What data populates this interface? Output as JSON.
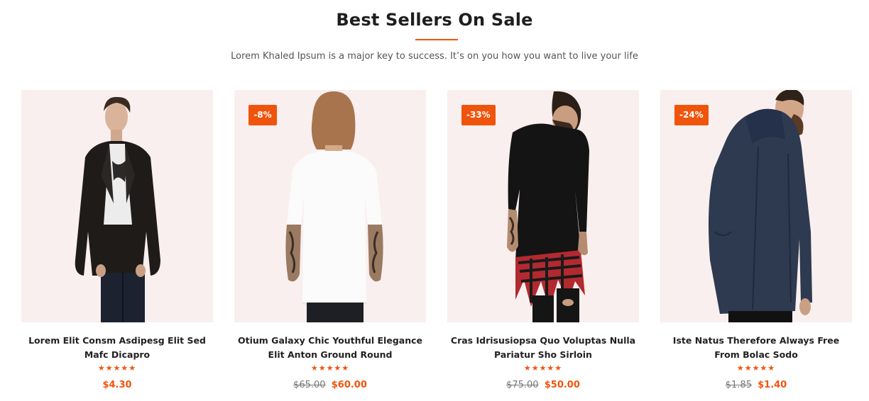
{
  "section": {
    "title": "Best Sellers On Sale",
    "subtitle": "Lorem Khaled Ipsum is a major key to success. It’s on you how you want to live your life",
    "accent_color": "#f0540c"
  },
  "products": [
    {
      "name": "Lorem Elit Consm Asdipesg Elit Sed Mafc Dicapro",
      "discount": "",
      "rating": 5,
      "stars": "★★★★★",
      "old_price": "",
      "price": "$4.30",
      "image": "man-leather-jacket-photo"
    },
    {
      "name": "Otium Galaxy Chic Youthful Elegance Elit Anton Ground Round",
      "discount": "-8%",
      "rating": 5,
      "stars": "★★★★★",
      "old_price": "$65.00",
      "price": "$60.00",
      "image": "man-white-tshirt-back-photo"
    },
    {
      "name": "Cras Idrisusiopsa Quo Voluptas Nulla Pariatur Sho Sirloin",
      "discount": "-33%",
      "rating": 4.5,
      "stars": "★★★★★",
      "old_price": "$75.00",
      "price": "$50.00",
      "image": "man-black-tshirt-plaid-photo"
    },
    {
      "name": "Iste Natus Therefore Always Free From Bolac Sodo",
      "discount": "-24%",
      "rating": 5,
      "stars": "★★★★★",
      "old_price": "$1.85",
      "price": "$1.40",
      "image": "man-navy-parka-photo"
    }
  ]
}
